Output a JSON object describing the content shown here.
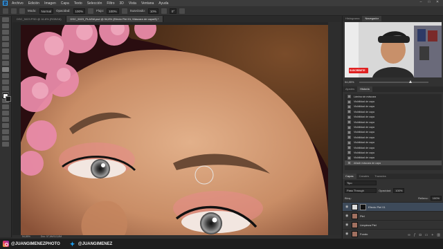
{
  "menubar": {
    "logo": "Ps",
    "items": [
      "Archivo",
      "Edición",
      "Imagen",
      "Capa",
      "Texto",
      "Selección",
      "Filtro",
      "3D",
      "Vista",
      "Ventana",
      "Ayuda"
    ],
    "window_controls": [
      "–",
      "□",
      "✕"
    ]
  },
  "options": {
    "mode_label": "Modo:",
    "mode_value": "Normal",
    "opacity_label": "Opacidad:",
    "opacity_value": "100%",
    "flow_label": "Flujo:",
    "flow_value": "100%",
    "smoothing_label": "Suavizado:",
    "smoothing_value": "10%",
    "angle_value": "0°"
  },
  "tabs": [
    {
      "label": "DSC_5023.PSD @ 16.8% (RGB/16)"
    },
    {
      "label": "DSC_5023_PLASM.psd @ 54,8% (Efecto Piel 01, Máscara de capa/8) *"
    }
  ],
  "status": {
    "zoom": "54,85%",
    "doc": "Doc: 57,6M/113,8M"
  },
  "navigator": {
    "tabs": [
      "Histograma",
      "Navegador"
    ],
    "zoom": "54,85%",
    "badge": "SUSCRÍBETE"
  },
  "history": {
    "tabs": [
      "Ajustes",
      "Historia"
    ],
    "items": [
      "Lámina sin máscara",
      "Visibilidad de capa",
      "Visibilidad de capa",
      "Visibilidad de capa",
      "Visibilidad de capa",
      "Visibilidad de capa",
      "Visibilidad de capa",
      "Visibilidad de capa",
      "Visibilidad de capa",
      "Visibilidad de capa",
      "Visibilidad de capa",
      "Visibilidad de capa",
      "Visibilidad de capa",
      "Añadir máscara de capa"
    ]
  },
  "layers": {
    "tabs": [
      "Capas",
      "Canales",
      "Trazados"
    ],
    "kind_label": "Tipo",
    "blend_value": "Pass Through",
    "opacity_label": "Opacidad:",
    "opacity_value": "100%",
    "lock_label": "Bloq.:",
    "fill_label": "Relleno:",
    "fill_value": "100%",
    "items": [
      {
        "name": "Efecto Piel 01"
      },
      {
        "name": "Piel"
      },
      {
        "name": "Limpieza Piel"
      },
      {
        "name": "Fondo"
      }
    ]
  },
  "footer": {
    "instagram": "@JUANGIMENEZPHOTO",
    "twitter": "@JUANGIMENEZ"
  }
}
